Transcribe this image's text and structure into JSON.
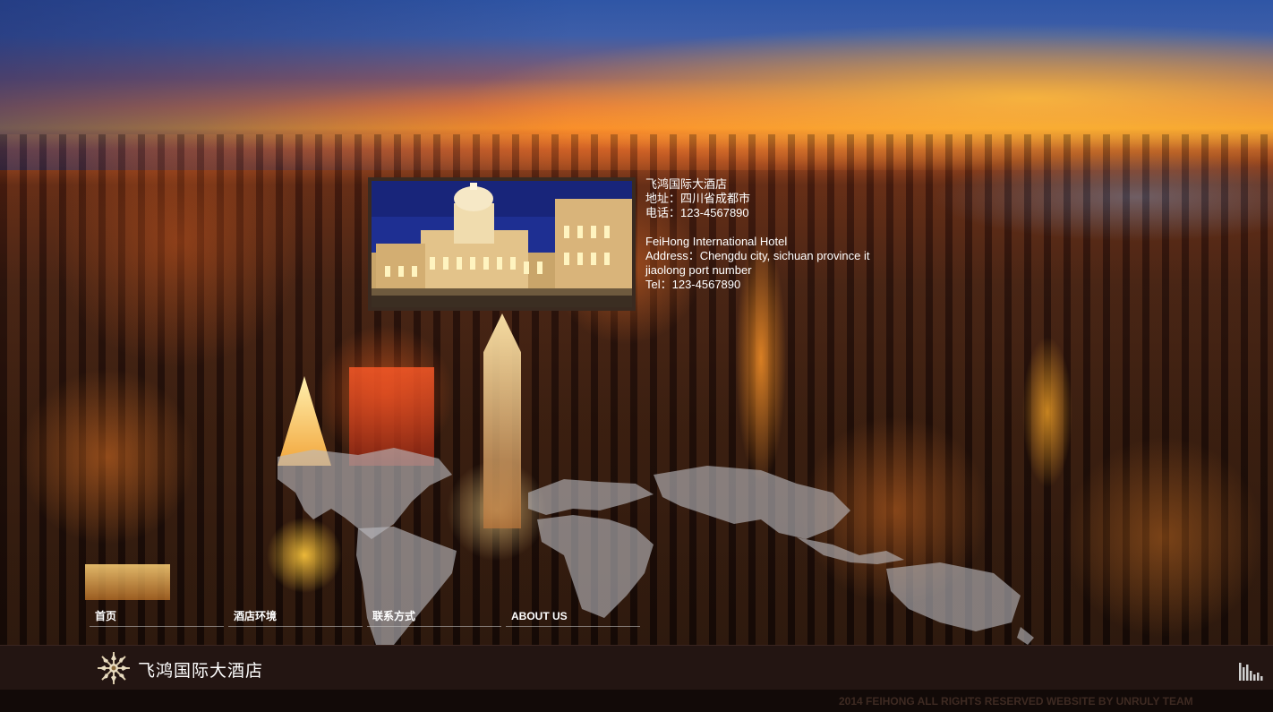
{
  "hotel": {
    "cn_name": "飞鸿国际大酒店",
    "cn_address": "地址：四川省成都市",
    "cn_tel": "电话：123-4567890",
    "en_name": "FeiHong International Hotel",
    "en_address": "Address：Chengdu city, sichuan province it",
    "en_address_2": "jiaolong port number",
    "en_tel": "Tel：123-4567890"
  },
  "nav": {
    "items": [
      {
        "label": "首页"
      },
      {
        "label": "酒店环境"
      },
      {
        "label": "联系方式"
      },
      {
        "label": "ABOUT US"
      }
    ]
  },
  "footer": {
    "logo_text": "飞鸿国际大酒店",
    "copyright": "2014 FEIHONG ALL RIGHTS RESERVED WEBSITE BY UNRULY TEAM"
  },
  "icons": {
    "logo": "snowflake-emblem-icon",
    "music": "equalizer-bars-icon"
  },
  "colors": {
    "footer_bg": "#231512",
    "copyright_bg": "#120a08",
    "copyright_text": "#3e2a22",
    "nav_text": "#ffffff"
  }
}
